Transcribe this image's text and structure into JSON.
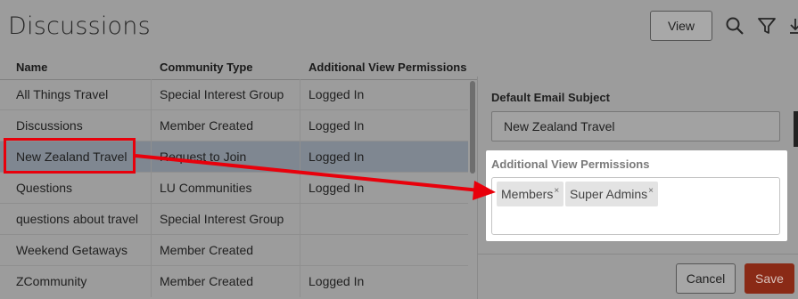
{
  "page": {
    "title": "Discussions",
    "view_label": "View"
  },
  "table": {
    "columns": [
      "Name",
      "Community Type",
      "Additional View Permissions"
    ],
    "rows": [
      {
        "name": "All Things Travel",
        "type": "Special Interest Group",
        "perm": "Logged In"
      },
      {
        "name": "Discussions",
        "type": "Member Created",
        "perm": "Logged In"
      },
      {
        "name": "New Zealand Travel",
        "type": "Request to Join",
        "perm": "Logged In"
      },
      {
        "name": "Questions",
        "type": "LU Communities",
        "perm": "Logged In"
      },
      {
        "name": "questions about travel",
        "type": "Special Interest Group",
        "perm": ""
      },
      {
        "name": "Weekend Getaways",
        "type": "Member Created",
        "perm": ""
      },
      {
        "name": "ZCommunity",
        "type": "Member Created",
        "perm": "Logged In"
      }
    ]
  },
  "panel": {
    "email_subject_label": "Default Email Subject",
    "email_subject_value": "New Zealand Travel",
    "permissions_label": "Additional View Permissions",
    "chips": [
      "Members",
      "Super Admins"
    ],
    "chip_remove": "×",
    "cancel_label": "Cancel",
    "save_label": "Save"
  },
  "icons": {
    "search": "search-icon",
    "filter": "filter-icon",
    "download": "download-icon"
  },
  "colors": {
    "annotation": "#e8000b",
    "save_button": "#8a2a16",
    "overlay": "#9c9c9c"
  }
}
